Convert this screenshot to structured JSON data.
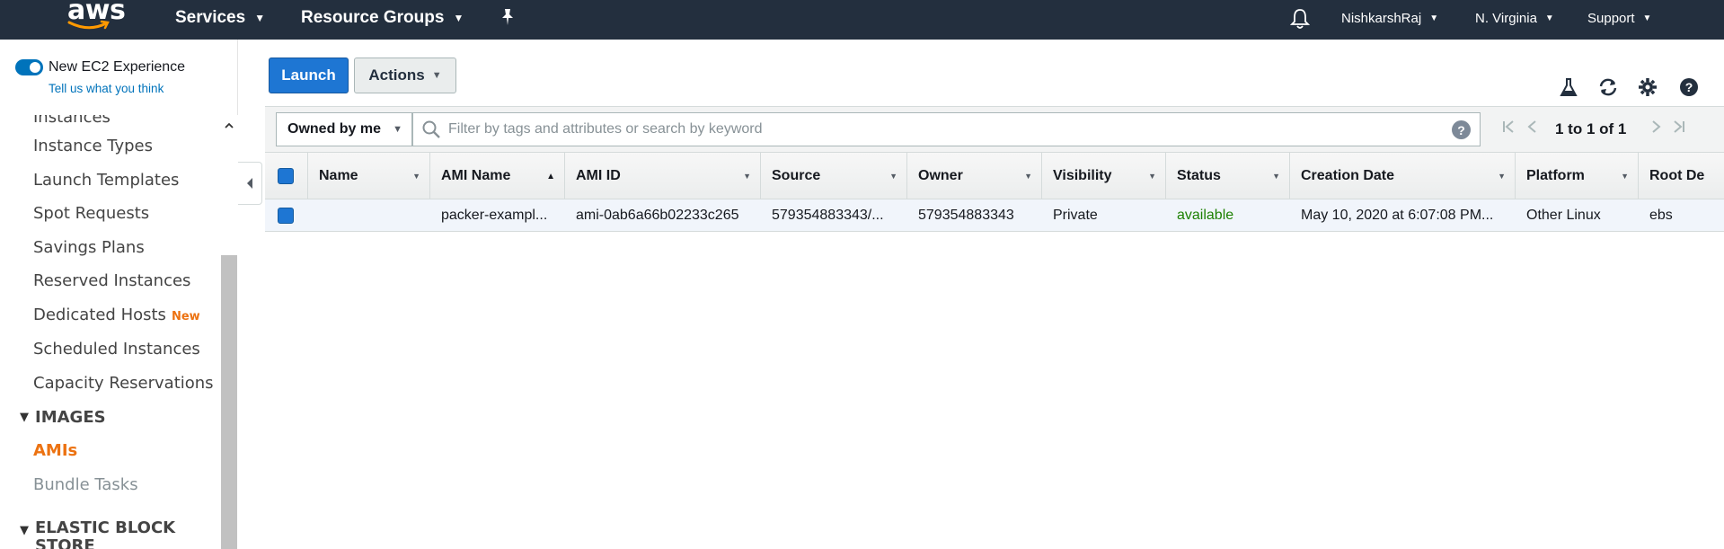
{
  "topnav": {
    "logo_text": "aws",
    "services": "Services",
    "resource_groups": "Resource Groups",
    "user": "NishkarshRaj",
    "region": "N. Virginia",
    "support": "Support"
  },
  "sidebar": {
    "toggle_label": "New EC2 Experience",
    "feedback_link": "Tell us what you think",
    "items": {
      "instances": "Instances",
      "instance_types": "Instance Types",
      "launch_templates": "Launch Templates",
      "spot_requests": "Spot Requests",
      "savings_plans": "Savings Plans",
      "reserved_instances": "Reserved Instances",
      "dedicated_hosts": "Dedicated Hosts",
      "dedicated_hosts_badge": "New",
      "scheduled_instances": "Scheduled Instances",
      "capacity_reservations": "Capacity Reservations",
      "images_section": "IMAGES",
      "amis": "AMIs",
      "bundle_tasks": "Bundle Tasks",
      "ebs_section": "ELASTIC BLOCK STORE"
    }
  },
  "toolbar": {
    "launch_label": "Launch",
    "actions_label": "Actions"
  },
  "filter": {
    "owned_label": "Owned by me",
    "search_placeholder": "Filter by tags and attributes or search by keyword",
    "pager_text": "1 to 1 of 1"
  },
  "table": {
    "columns": [
      "Name",
      "AMI Name",
      "AMI ID",
      "Source",
      "Owner",
      "Visibility",
      "Status",
      "Creation Date",
      "Platform",
      "Root De"
    ],
    "rows": [
      {
        "name": "",
        "ami_name": "packer-exampl...",
        "ami_id": "ami-0ab6a66b02233c265",
        "source": "579354883343/...",
        "owner": "579354883343",
        "visibility": "Private",
        "status": "available",
        "creation_date": "May 10, 2020 at 6:07:08 PM...",
        "platform": "Other Linux",
        "root_device": "ebs"
      }
    ]
  },
  "colors": {
    "nav_bg": "#232f3e",
    "primary_button": "#1e76d3",
    "active_accent": "#ec7211",
    "status_available": "#1d8102"
  }
}
